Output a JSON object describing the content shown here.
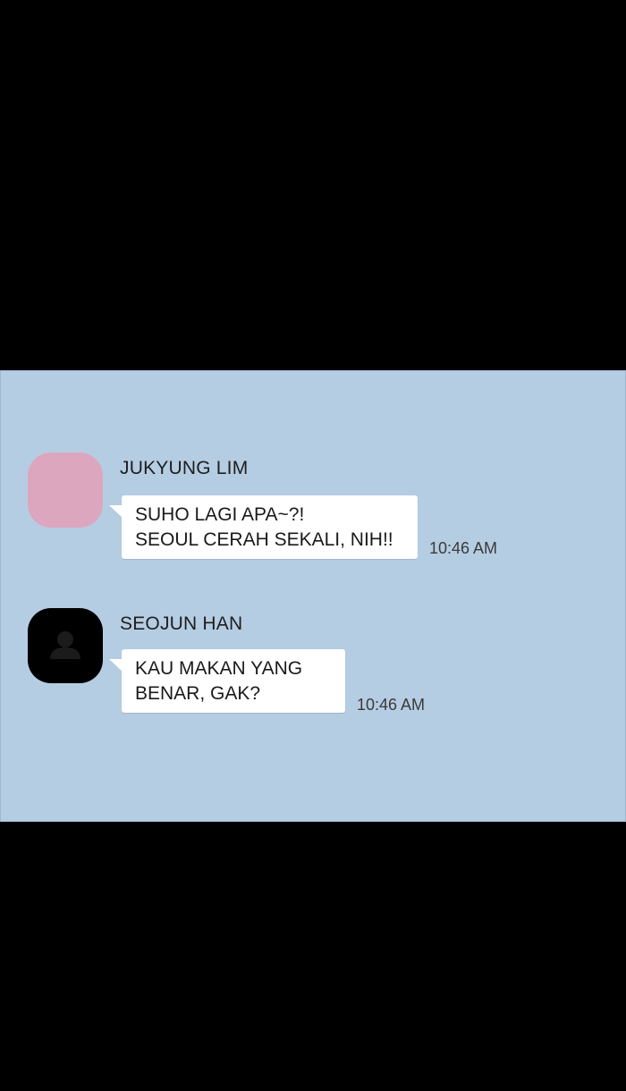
{
  "colors": {
    "background": "#000000",
    "chat_background": "#b5cde3",
    "bubble": "#ffffff",
    "avatar_pink": "#dca7be",
    "avatar_black": "#000000"
  },
  "messages": [
    {
      "sender": "JUKYUNG LIM",
      "avatar": "pink-square-avatar",
      "lines": [
        "SUHO LAGI APA~?!",
        "SEOUL CERAH SEKALI, NIH!!"
      ],
      "time": "10:46 AM"
    },
    {
      "sender": "SEOJUN HAN",
      "avatar": "person-icon",
      "lines": [
        "KAU MAKAN YANG",
        "BENAR, GAK?"
      ],
      "time": "10:46 AM"
    }
  ]
}
